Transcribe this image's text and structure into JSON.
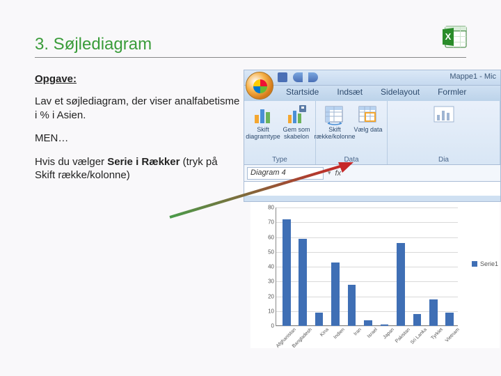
{
  "title": "3. Søjlediagram",
  "heading": "Opgave:",
  "para1": "Lav et søjlediagram, der viser analfabetisme i % i Asien.",
  "para2": "MEN…",
  "para3_pre": "Hvis du vælger ",
  "para3_bold": "Serie i Rækker",
  "para3_post": " (tryk på Skift række/kolonne)",
  "workbook_name": "Mappe1 - Mic",
  "qat": {
    "save": "save-icon",
    "undo": "undo-icon",
    "redo": "redo-icon"
  },
  "tabs": [
    "Startside",
    "Indsæt",
    "Sidelayout",
    "Formler"
  ],
  "ribbon": {
    "groups": [
      {
        "label": "Type",
        "buttons": [
          {
            "name": "Skift diagramtype",
            "icon": "chart-type"
          },
          {
            "name": "Gem som skabelon",
            "icon": "chart-save"
          }
        ]
      },
      {
        "label": "Data",
        "buttons": [
          {
            "name": "Skift række/kolonne",
            "icon": "switch-rowcol"
          },
          {
            "name": "Vælg data",
            "icon": "select-data"
          }
        ]
      },
      {
        "label": "Dia",
        "buttons": [
          {
            "name": "",
            "icon": "layout"
          }
        ]
      }
    ]
  },
  "namebox": "Diagram 4",
  "fx_label": "fx",
  "chart_data": {
    "type": "bar",
    "categories": [
      "Afghanistan",
      "Bangladesh",
      "Kina",
      "Indien",
      "Iran",
      "Israel",
      "Japan",
      "Pakistan",
      "Sri Lanka",
      "Tyrkiet",
      "Vietnam"
    ],
    "values": [
      72,
      59,
      9,
      43,
      28,
      4,
      1,
      56,
      8,
      18,
      9
    ],
    "series_name": "Serie1",
    "ylim": [
      0,
      80
    ],
    "yticks": [
      0,
      10,
      20,
      30,
      40,
      50,
      60,
      70,
      80
    ]
  }
}
